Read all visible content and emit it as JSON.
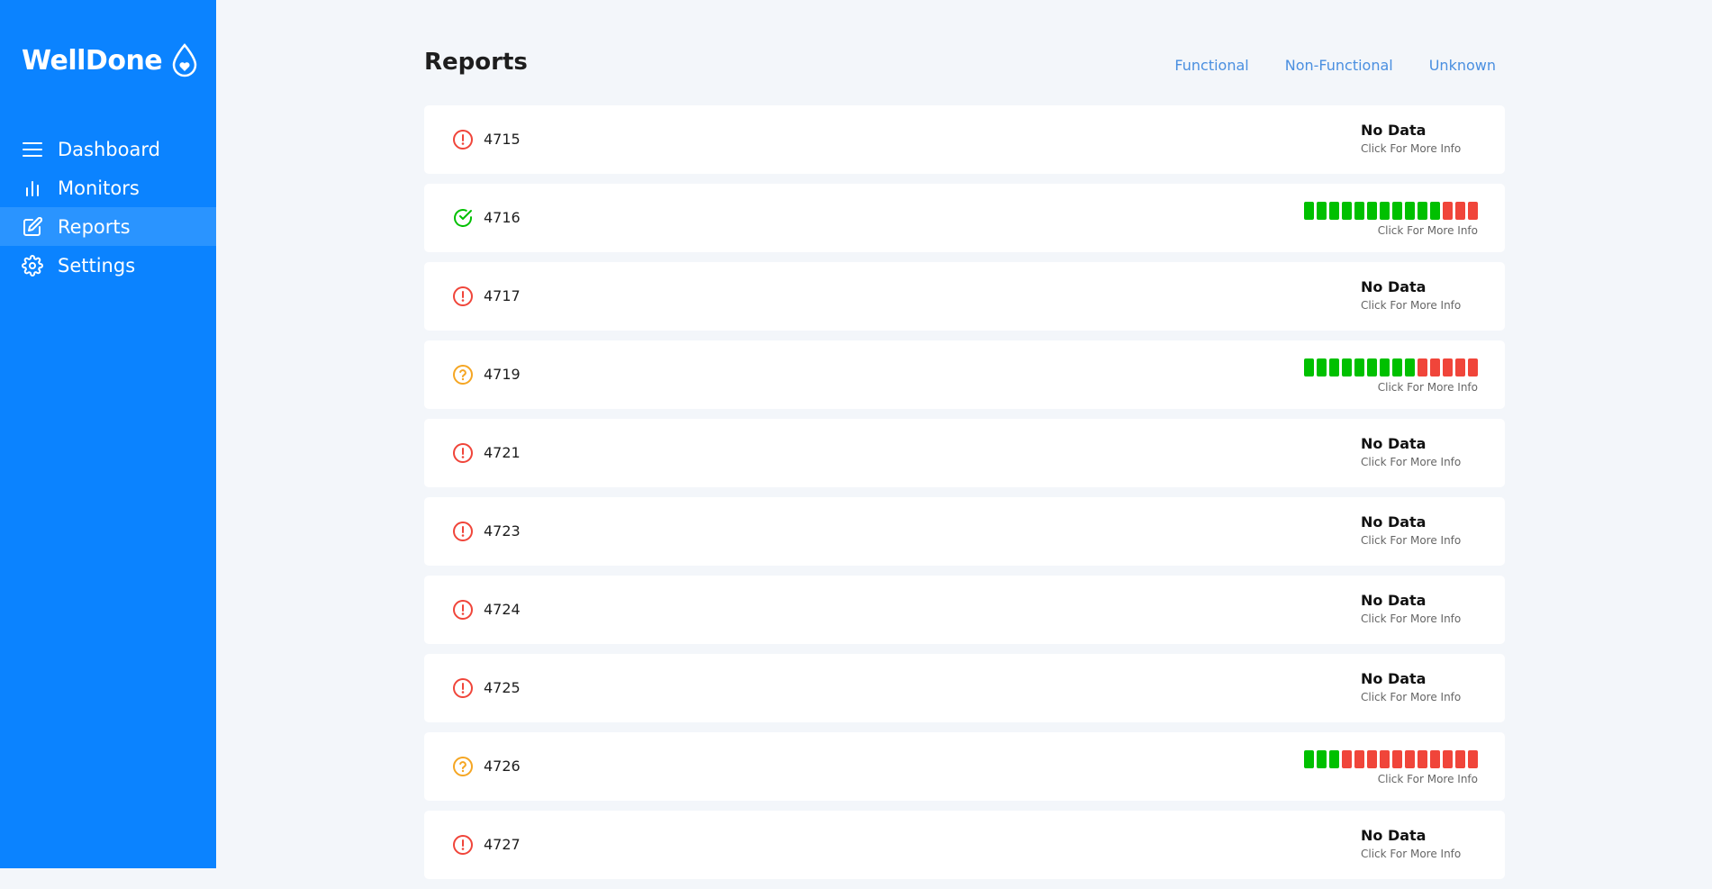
{
  "sidebar": {
    "brand": "WellDone",
    "items": [
      {
        "label": "Dashboard",
        "icon": "menu-icon",
        "active": false
      },
      {
        "label": "Monitors",
        "icon": "bar-chart-icon",
        "active": false
      },
      {
        "label": "Reports",
        "icon": "edit-icon",
        "active": true
      },
      {
        "label": "Settings",
        "icon": "gear-icon",
        "active": false
      }
    ]
  },
  "header": {
    "title": "Reports",
    "filters": [
      "Functional",
      "Non-Functional",
      "Unknown"
    ]
  },
  "colors": {
    "brand": "#0b83ff",
    "ok": "#00c000",
    "bad": "#f0453a",
    "unknown": "#f5a623",
    "link": "#4a8fe0"
  },
  "more_info": "Click For More Info",
  "no_data": "No Data",
  "reports": [
    {
      "id": "4715",
      "status": "error",
      "bars": null
    },
    {
      "id": "4716",
      "status": "ok",
      "bars": {
        "green": 11,
        "red": 3
      }
    },
    {
      "id": "4717",
      "status": "error",
      "bars": null
    },
    {
      "id": "4719",
      "status": "unknown",
      "bars": {
        "green": 9,
        "red": 5
      }
    },
    {
      "id": "4721",
      "status": "error",
      "bars": null
    },
    {
      "id": "4723",
      "status": "error",
      "bars": null
    },
    {
      "id": "4724",
      "status": "error",
      "bars": null
    },
    {
      "id": "4725",
      "status": "error",
      "bars": null
    },
    {
      "id": "4726",
      "status": "unknown",
      "bars": {
        "green": 3,
        "red": 11
      }
    },
    {
      "id": "4727",
      "status": "error",
      "bars": null
    }
  ]
}
